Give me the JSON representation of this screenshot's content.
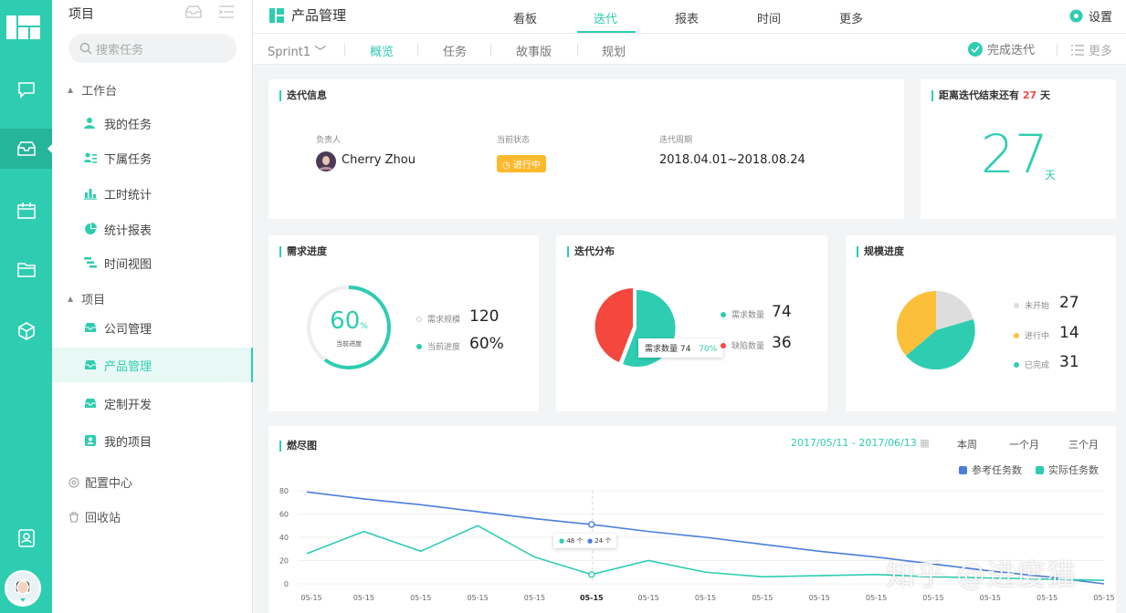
{
  "sidebar": {
    "title": "项目",
    "search_placeholder": "搜索任务",
    "group_workbench": "工作台",
    "workbench_items": [
      "我的任务",
      "下属任务",
      "工时统计",
      "统计报表",
      "时间视图"
    ],
    "group_project": "项目",
    "project_items": [
      "公司管理",
      "产品管理",
      "定制开发",
      "我的项目"
    ],
    "config": "配置中心",
    "recycle": "回收站"
  },
  "topbar": {
    "title": "产品管理",
    "tabs": [
      "看板",
      "迭代",
      "报表",
      "时间",
      "更多"
    ],
    "settings": "设置"
  },
  "subbar": {
    "sprint": "Sprint1",
    "tabs": [
      "概览",
      "任务",
      "故事版",
      "规划"
    ],
    "complete": "完成迭代",
    "more": "更多"
  },
  "iteration": {
    "title": "迭代信息",
    "owner_label": "负责人",
    "owner": "Cherry Zhou",
    "status_label": "当前状态",
    "status": "进行中",
    "period_label": "迭代周期",
    "period": "2018.04.01~2018.08.24"
  },
  "countdown": {
    "title_prefix": "距离迭代结束还有",
    "days": "27",
    "unit": "天"
  },
  "demand": {
    "title": "需求进度",
    "percent": "60",
    "percent_sign": "%",
    "ring_label": "当前进度",
    "scale_label": "需求规模",
    "scale_value": "120",
    "progress_label": "当前进度",
    "progress_value": "60%",
    "ring_fraction": 0.6
  },
  "distribution": {
    "title": "迭代分布",
    "legend": [
      {
        "label": "需求数量",
        "value": "74",
        "color": "#2ecdb1"
      },
      {
        "label": "缺陷数量",
        "value": "36",
        "color": "#f4483f"
      }
    ],
    "tooltip_label": "需求数量 74",
    "tooltip_pct": "70%"
  },
  "scale": {
    "title": "规模进度",
    "legend": [
      {
        "label": "未开始",
        "value": "27",
        "color": "#dddddd"
      },
      {
        "label": "进行中",
        "value": "14",
        "color": "#fbbf3a"
      },
      {
        "label": "已完成",
        "value": "31",
        "color": "#2ecdb1"
      }
    ]
  },
  "burndown": {
    "title": "燃尽图",
    "range": "2017/05/11 - 2017/06/13",
    "periods": [
      "本周",
      "一个月",
      "三个月"
    ],
    "legend_ref": "参考任务数",
    "legend_actual": "实际任务数",
    "tooltip_a": "48 个",
    "tooltip_b": "24 个"
  },
  "chart_data": {
    "type": "line",
    "x": [
      "05-15",
      "05-15",
      "05-15",
      "05-15",
      "05-15",
      "05-15",
      "05-15",
      "05-15",
      "05-15",
      "05-15",
      "05-15",
      "05-15",
      "05-15",
      "05-15",
      "05-15"
    ],
    "yticks": [
      "0",
      "20",
      "40",
      "60",
      "80"
    ],
    "ylim": [
      0,
      80
    ],
    "series": [
      {
        "name": "参考任务数",
        "color": "#4a7fdc",
        "values": [
          79,
          73,
          68,
          62,
          56,
          51,
          45,
          40,
          34,
          28,
          23,
          17,
          11,
          6,
          0
        ]
      },
      {
        "name": "实际任务数",
        "color": "#2ecdb1",
        "values": [
          26,
          45,
          28,
          50,
          23,
          8,
          20,
          10,
          6,
          7,
          8,
          6,
          5,
          4,
          3
        ]
      }
    ]
  },
  "watermark": "知乎 @进度猫",
  "colors": {
    "accent": "#2ecdb1",
    "danger": "#f4483f",
    "warn": "#fbbf3a",
    "blue": "#4a7fdc"
  }
}
